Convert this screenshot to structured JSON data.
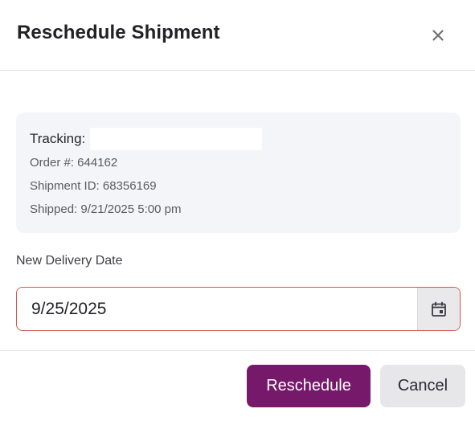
{
  "dialog": {
    "title": "Reschedule Shipment"
  },
  "shipment_info": {
    "tracking_label": "Tracking:",
    "tracking_value": "",
    "order": "Order #: 644162",
    "shipment_id": "Shipment ID: 68356169",
    "shipped": "Shipped: 9/21/2025 5:00 pm"
  },
  "delivery": {
    "label": "New Delivery Date",
    "value": "9/25/2025"
  },
  "actions": {
    "primary_label": "Reschedule",
    "secondary_label": "Cancel"
  },
  "icons": {
    "close": "close-icon",
    "calendar": "calendar-icon"
  },
  "colors": {
    "primary": "#77196a",
    "field_border_error": "#d4534e",
    "card_background": "#f4f5f8",
    "secondary_button": "#e7e7ea"
  }
}
